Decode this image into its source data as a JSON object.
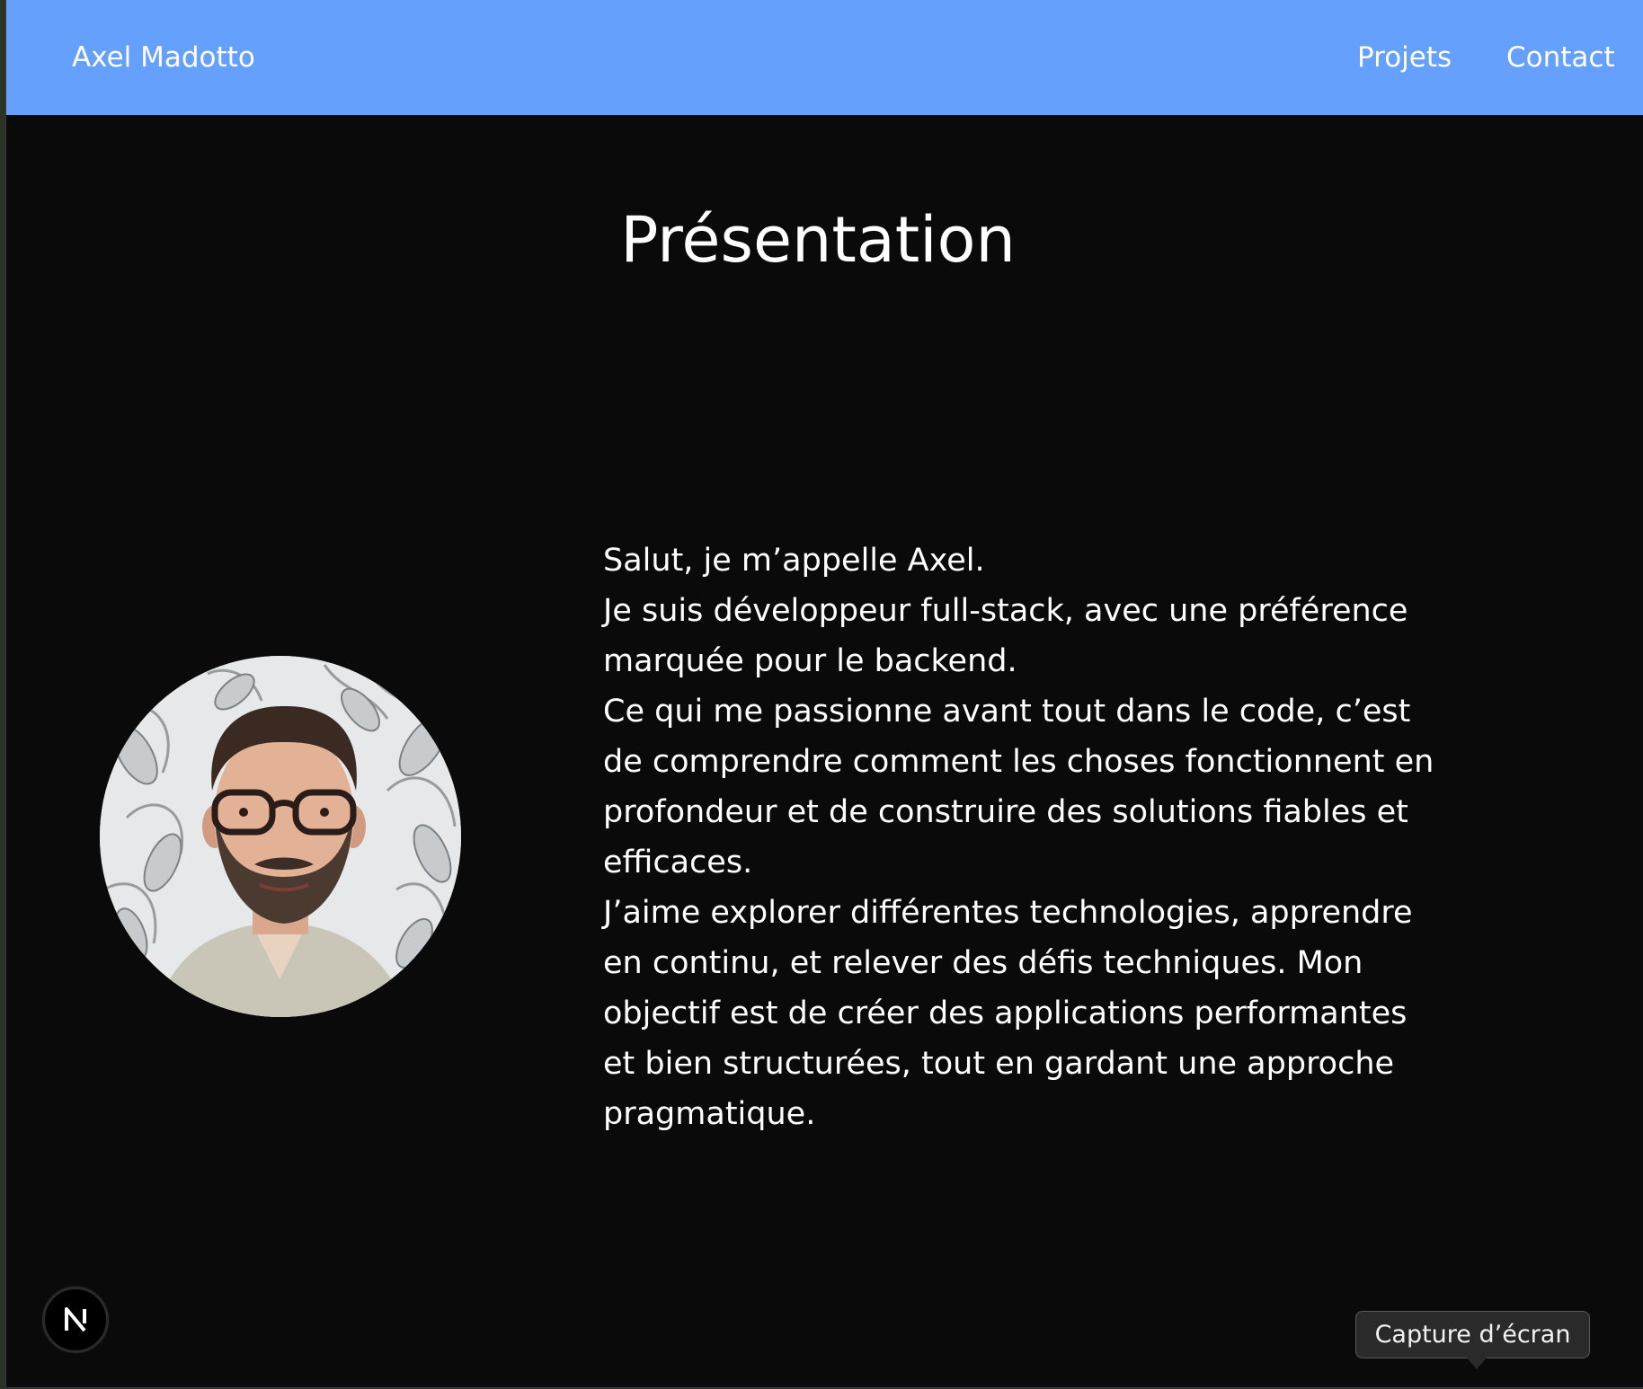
{
  "navbar": {
    "brand": "Axel Madotto",
    "links": [
      "Projets",
      "Contact"
    ]
  },
  "main": {
    "title": "Présentation",
    "avatar_alt": "Photo de profil d'Axel Madotto",
    "bio_paragraphs": [
      "Salut, je m’appelle Axel.",
      "Je suis développeur full-stack, avec une préférence marquée pour le backend.",
      "Ce qui me passionne avant tout dans le code, c’est de comprendre comment les choses fonctionnent en profondeur et de construire des solutions fiables et efficaces.",
      "J’aime explorer différentes technologies, apprendre en continu, et relever des défis techniques. Mon objectif est de créer des applications performantes et bien structurées, tout en gardant une approche pragmatique."
    ]
  },
  "overlay": {
    "next_badge_icon": "nextjs-icon",
    "next_badge_letter": "N",
    "tooltip": "Capture d’écran"
  },
  "colors": {
    "navbar": "#64a0fc",
    "background": "#0a0a0a",
    "text": "#ffffff"
  }
}
